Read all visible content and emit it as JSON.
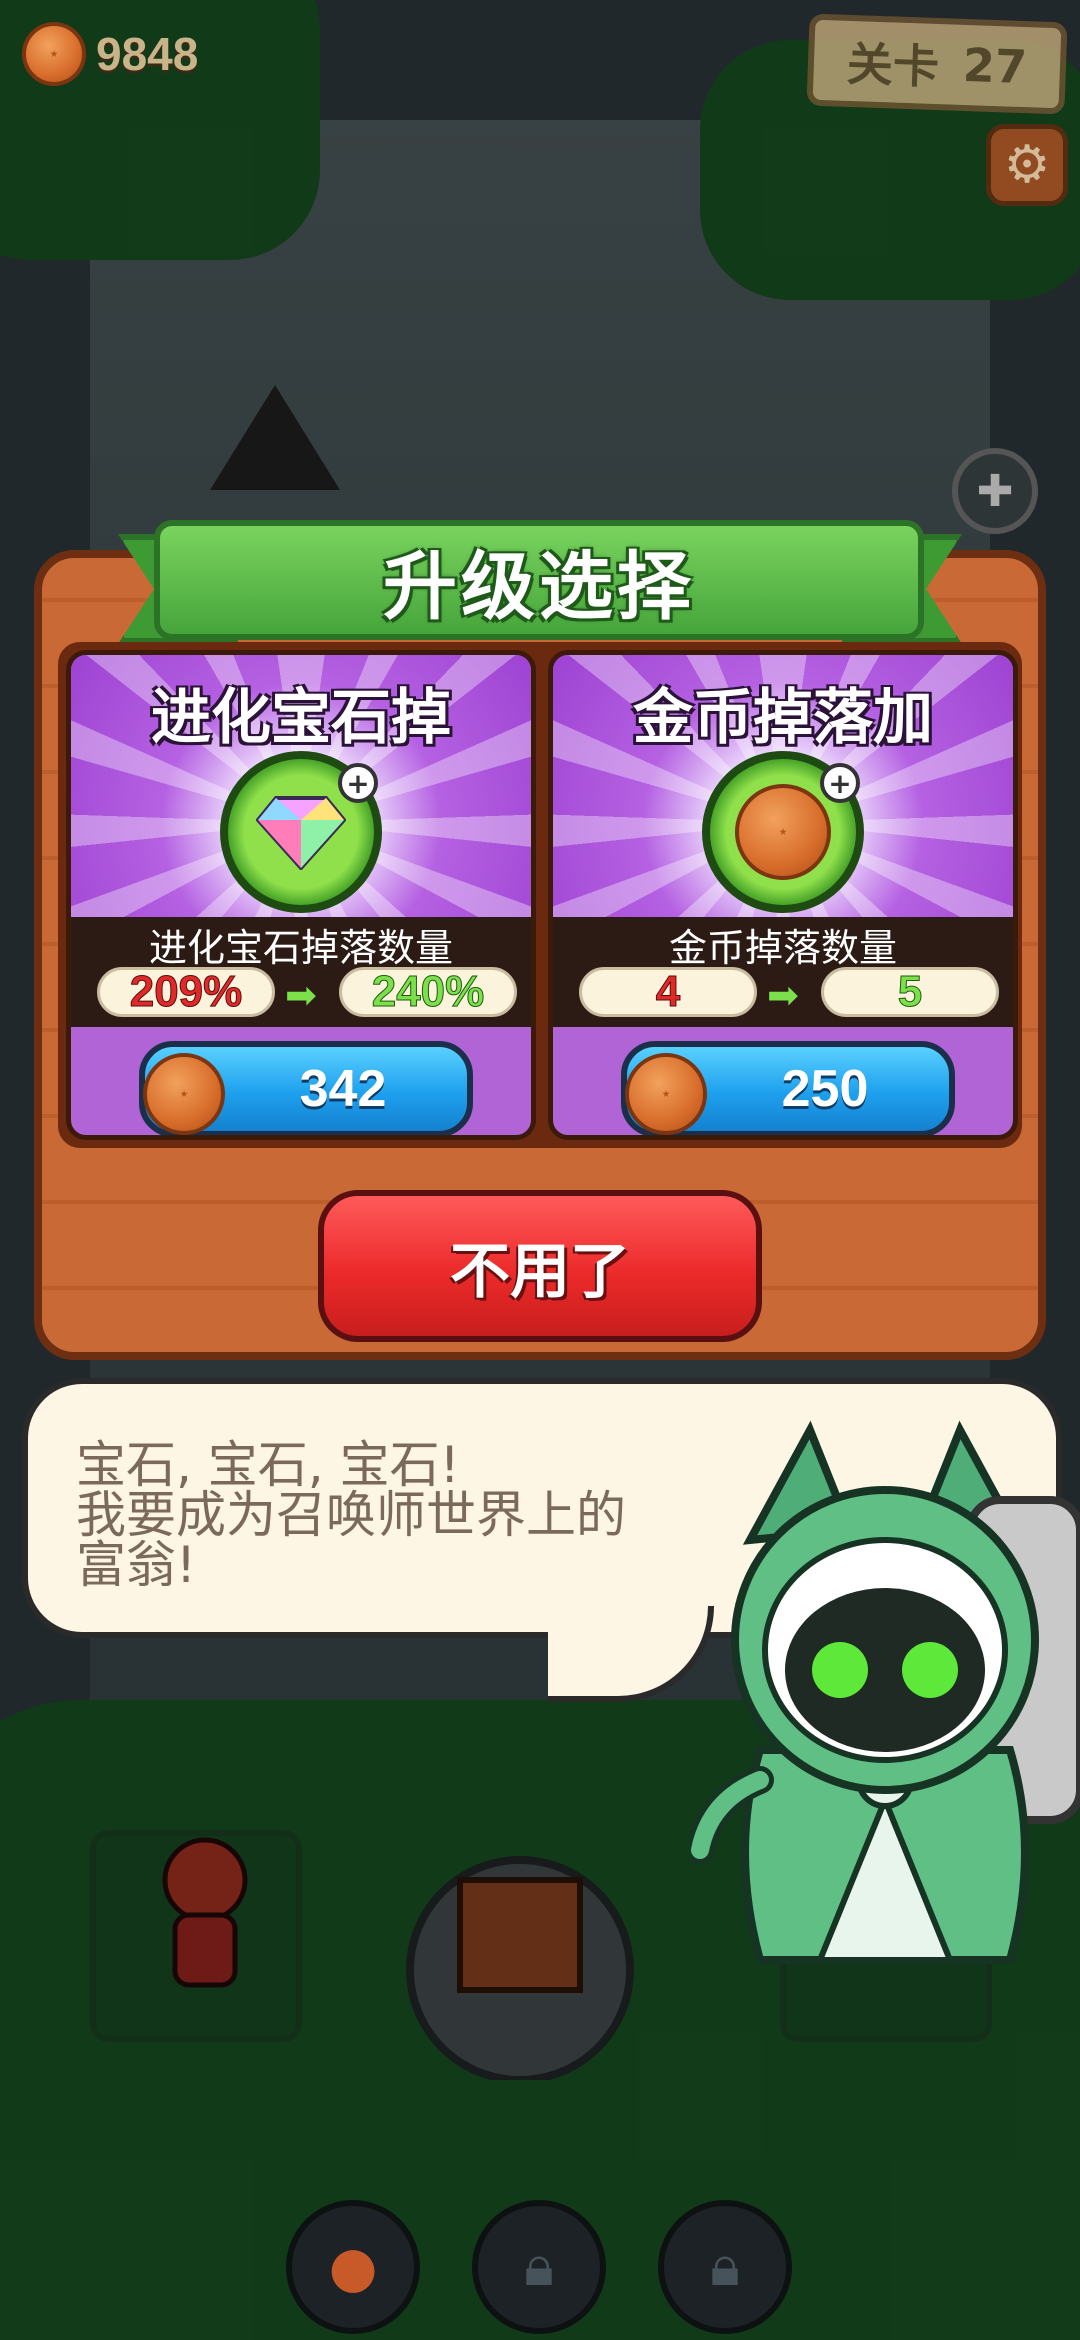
{
  "hud": {
    "coins": "9848",
    "level_label": "关卡",
    "level_number": "27",
    "coin_icon": "coin-icon",
    "settings_icon": "gear-icon"
  },
  "panel": {
    "title": "升级选择",
    "cards": [
      {
        "name": "进化宝石掉",
        "icon": "gem-plus-icon",
        "stat_label": "进化宝石掉落数量",
        "current": "209%",
        "next": "240%",
        "price": "342"
      },
      {
        "name": "金币掉落加",
        "icon": "coin-plus-icon",
        "stat_label": "金币掉落数量",
        "current": "4",
        "next": "5",
        "price": "250"
      }
    ],
    "decline_label": "不用了"
  },
  "dialog": {
    "lines": [
      "宝石, 宝石, 宝石!",
      "我要成为召唤师世界上的",
      "富翁!"
    ]
  },
  "colors": {
    "ribbon": "#46a53b",
    "buy_button": "#1ea0ee",
    "decline_button": "#ec2a2a",
    "card_bg": "#9b3fd1"
  }
}
